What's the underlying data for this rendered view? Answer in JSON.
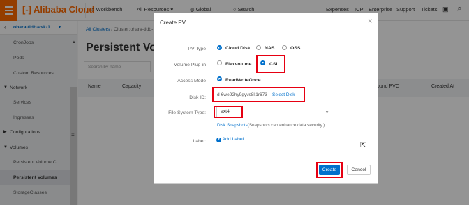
{
  "topbar": {
    "brand": "Alibaba Cloud",
    "workbench": "Workbench",
    "all_resources": "All Resources",
    "global": "Global",
    "search_placeholder": "Search",
    "expenses": "Expenses",
    "icp": "ICP",
    "enterprise": "Enterprise",
    "support": "Support",
    "tickets": "Tickets"
  },
  "sidebar": {
    "cluster": "ohara-tidb-ask-1",
    "items": {
      "cronjobs": "CronJobs",
      "pods": "Pods",
      "custom_resources": "Custom Resources",
      "network": "Network",
      "services": "Services",
      "ingresses": "Ingresses",
      "configurations": "Configurations",
      "volumes": "Volumes",
      "persistent_volume_claims": "Persistent Volume Cl...",
      "persistent_volumes": "Persistent Volumes",
      "storage_classes": "StorageClasses"
    }
  },
  "main": {
    "breadcrumb_root": "All Clusters",
    "breadcrumb_cluster": "Cluster:ohara-tidb-",
    "title": "Persistent Volu",
    "search_placeholder": "Search by name",
    "columns": {
      "name": "Name",
      "capacity": "Capacity",
      "bound_pvc": "ound PVC",
      "created_at": "Created At"
    }
  },
  "modal": {
    "title": "Create PV",
    "pv_type_label": "PV Type",
    "pv_types": {
      "cloud_disk": "Cloud Disk",
      "nas": "NAS",
      "oss": "OSS"
    },
    "plugin_label": "Volume Plug-in",
    "plugins": {
      "flexvolume": "Flexvolume",
      "csi": "CSI"
    },
    "access_mode_label": "Access Mode",
    "access_mode_value": "ReadWriteOnce",
    "disk_id_label": "Disk ID:",
    "disk_id_value": "d-6we92hy9gyvs8li1r673",
    "select_disk": "Select Disk",
    "fs_type_label": "File System Type:",
    "fs_type_value": "ext4",
    "snapshot_link": "Disk Snapshots",
    "snapshot_text": "(Snapshots can enhance data security.)",
    "label_label": "Label:",
    "add_label": "Add Label",
    "create": "Create",
    "cancel": "Cancel"
  },
  "colors": {
    "accent": "#ff6a00",
    "primary": "#0070cc",
    "highlight": "#e60012"
  }
}
